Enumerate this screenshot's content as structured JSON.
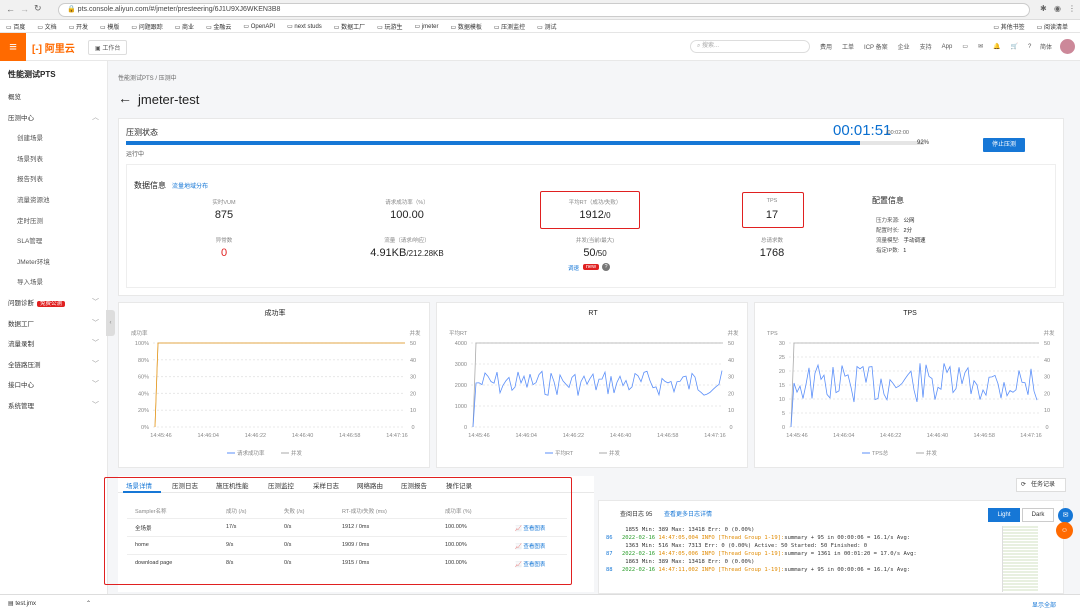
{
  "browser": {
    "url": "pts.console.aliyun.com/#/jmeter/presteering/6J1U9XJ6WKEN3B8",
    "bookmarks": [
      "百度",
      "文档",
      "开发",
      "模版",
      "问题跟踪",
      "商业",
      "金融云",
      "OpenAPI",
      "next studs",
      "数据工厂",
      "玩游生",
      "jmeter",
      "数据模板",
      "压测监控",
      "测试"
    ],
    "bookmarks_right": [
      "其他书签",
      "阅读清单"
    ]
  },
  "header": {
    "logo": "阿里云",
    "workbench": "工作台",
    "search_placeholder": "搜索...",
    "menu": [
      "费用",
      "工单",
      "ICP 备案",
      "企业",
      "支持",
      "App"
    ],
    "lang": "简体"
  },
  "sidebar": {
    "title": "性能测试PTS",
    "items": [
      {
        "label": "概览",
        "sub": false
      },
      {
        "label": "压测中心",
        "sub": false,
        "expandable": true
      },
      {
        "label": "创建场景",
        "sub": true
      },
      {
        "label": "场景列表",
        "sub": true
      },
      {
        "label": "报告列表",
        "sub": true
      },
      {
        "label": "流量资源池",
        "sub": true
      },
      {
        "label": "定时压测",
        "sub": true
      },
      {
        "label": "SLA管理",
        "sub": true
      },
      {
        "label": "JMeter环境",
        "sub": true
      },
      {
        "label": "导入场景",
        "sub": true
      },
      {
        "label": "问题诊断",
        "sub": false,
        "expandable": true,
        "badge": "免费公测"
      },
      {
        "label": "数据工厂",
        "sub": false,
        "expandable": true
      },
      {
        "label": "流量录制",
        "sub": false,
        "expandable": true
      },
      {
        "label": "全链路压测",
        "sub": false,
        "expandable": true
      },
      {
        "label": "接口中心",
        "sub": false,
        "expandable": true
      },
      {
        "label": "系统管理",
        "sub": false,
        "expandable": true
      }
    ]
  },
  "page": {
    "breadcrumb": "性能测试PTS  /  压测中",
    "title": "jmeter-test"
  },
  "status": {
    "label": "压测状态",
    "elapsed": "00:01:51",
    "total": "/00:02:00",
    "percent": "92%",
    "progress": 0.92,
    "state": "运行中",
    "stop_button": "停止压测"
  },
  "data_info": {
    "title": "数据信息",
    "link": "流量地域分布",
    "metrics": [
      {
        "label": "实时VUM",
        "value": "875",
        "color": "#222"
      },
      {
        "label": "请求成功率（%）",
        "value": "100.00",
        "color": "#222"
      },
      {
        "label": "平均RT（成功/失败）",
        "value": "1912",
        "value2": "/0",
        "color": "#222"
      },
      {
        "label": "TPS",
        "value": "17",
        "color": "#222"
      },
      {
        "label": "异常数",
        "value": "0",
        "color": "#e02020"
      },
      {
        "label": "流量（请求/响应）",
        "value": "4.91KB",
        "value2": "/212.28KB",
        "color": "#222"
      },
      {
        "label": "并发(当前/最大)",
        "value": "50",
        "value2": "/50",
        "color": "#222"
      },
      {
        "label": "总请求数",
        "value": "1768",
        "color": "#222"
      }
    ],
    "concurrency_extra": {
      "link": "调速",
      "badge": "new"
    }
  },
  "config": {
    "title": "配置信息",
    "rows": [
      {
        "k": "压力来源:",
        "v": "公网"
      },
      {
        "k": "配置时长:",
        "v": "2分"
      },
      {
        "k": "流量模型:",
        "v": "手动调速"
      },
      {
        "k": "指定IP数:",
        "v": "1"
      }
    ]
  },
  "charts": {
    "success": {
      "title": "成功率",
      "left_axis": "成功率",
      "right_axis": "并发",
      "left_ticks": [
        "0%",
        "20%",
        "40%",
        "60%",
        "80%",
        "100%"
      ],
      "right_ticks": [
        "0",
        "10",
        "20",
        "30",
        "40",
        "50"
      ],
      "x_ticks": [
        "14:45:46",
        "14:46:04",
        "14:46:22",
        "14:46:40",
        "14:46:58",
        "14:47:16"
      ],
      "legend": [
        "请求成功率",
        "并发"
      ]
    },
    "rt": {
      "title": "RT",
      "left_axis": "平均RT",
      "right_axis": "并发",
      "left_ticks": [
        "0",
        "1000",
        "2000",
        "3000",
        "4000"
      ],
      "right_ticks": [
        "0",
        "10",
        "20",
        "30",
        "40",
        "50"
      ],
      "x_ticks": [
        "14:45:46",
        "14:46:04",
        "14:46:22",
        "14:46:40",
        "14:46:58",
        "14:47:16"
      ],
      "legend": [
        "平均RT",
        "并发"
      ]
    },
    "tps": {
      "title": "TPS",
      "left_axis": "TPS",
      "right_axis": "并发",
      "left_ticks": [
        "0",
        "5",
        "10",
        "15",
        "20",
        "25",
        "30"
      ],
      "right_ticks": [
        "0",
        "10",
        "20",
        "30",
        "40",
        "50"
      ],
      "x_ticks": [
        "14:45:46",
        "14:46:04",
        "14:46:22",
        "14:46:40",
        "14:46:58",
        "14:47:16"
      ],
      "legend": [
        "TPS总",
        "并发"
      ]
    }
  },
  "tabs": [
    "场景详情",
    "压测日志",
    "施压机性能",
    "压测监控",
    "采样日志",
    "网络路由",
    "压测报告",
    "操作记录"
  ],
  "table": {
    "headers": [
      "Sampler名称",
      "成功 (/s)",
      "失败 (/s)",
      "RT-成功/失败 (ms)",
      "成功率 (%)"
    ],
    "rows": [
      {
        "name": "全场景",
        "ok": "17/s",
        "fail": "0/s",
        "rt": "1912 / 0ms",
        "rate": "100.00%",
        "link": "查看图表"
      },
      {
        "name": "home",
        "ok": "9/s",
        "fail": "0/s",
        "rt": "1909 / 0ms",
        "rate": "100.00%",
        "link": "查看图表"
      },
      {
        "name": "download page",
        "ok": "8/s",
        "fail": "0/s",
        "rt": "1915 / 0ms",
        "rate": "100.00%",
        "link": "查看图表"
      }
    ]
  },
  "log": {
    "title": "查阅日志  95",
    "link": "查看更多日志详情",
    "light": "Light",
    "dark": "Dark",
    "task_button": "任务记录",
    "lines": [
      {
        "n": "",
        "date": "",
        "info": "",
        "text": "   1855 Min:   389 Max: 13418 Err:     0 (0.00%)"
      },
      {
        "n": "86",
        "date": "2022-02-16",
        "info": " 14:47:05,004 INFO [Thread Group 1-19]:",
        "text": "summary +    95 in 00:00:06 =   16.1/s Avg:"
      },
      {
        "n": "",
        "date": "",
        "info": "",
        "text": "   1363 Min:   516 Max:  7313 Err:     0 (0.00%) Active: 50 Started: 50 Finished: 0"
      },
      {
        "n": "87",
        "date": "2022-02-16",
        "info": " 14:47:05,006 INFO [Thread Group 1-19]:",
        "text": "summary =   1361 in 00:01:20 =   17.0/s Avg:"
      },
      {
        "n": "",
        "date": "",
        "info": "",
        "text": "   1863 Min:   389 Max: 13418 Err:     0 (0.00%)"
      },
      {
        "n": "88",
        "date": "2022-02-16",
        "info": " 14:47:11,002 INFO [Thread Group 1-19]:",
        "text": "summary +    95 in 00:00:06 =   16.1/s Avg:"
      }
    ]
  },
  "download": {
    "file": "test.jmx",
    "all": "显示全部"
  }
}
